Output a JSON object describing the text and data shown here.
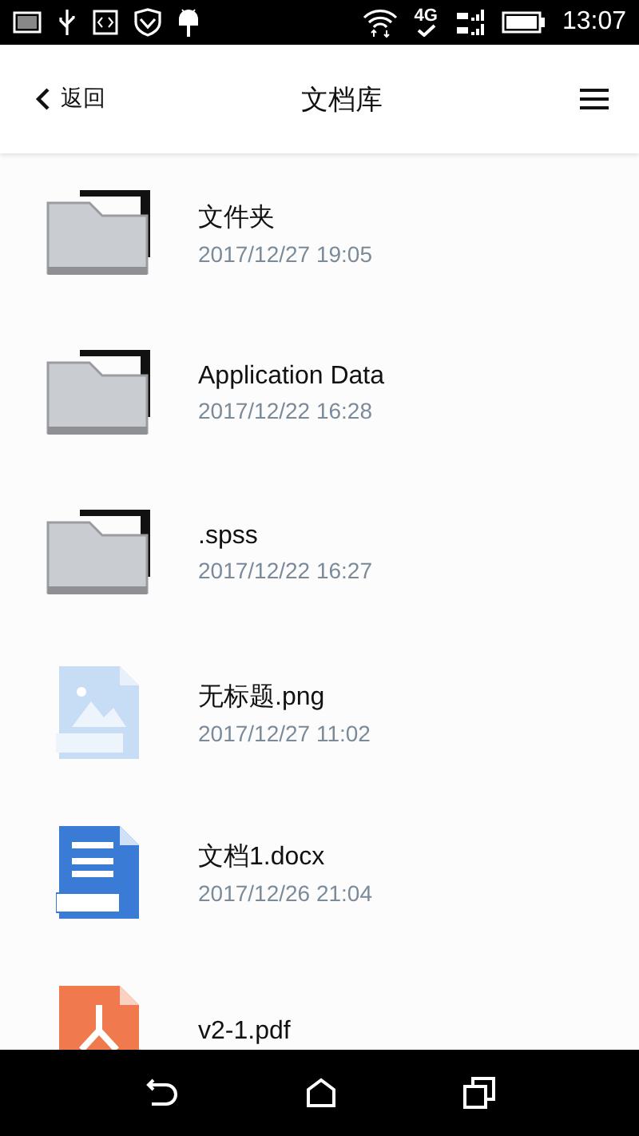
{
  "status_bar": {
    "network": "4G",
    "time": "13:07"
  },
  "header": {
    "back": "返回",
    "title": "文档库"
  },
  "files": [
    {
      "kind": "folder",
      "name": "文件夹",
      "date": "2017/12/27 19:05"
    },
    {
      "kind": "folder",
      "name": "Application Data",
      "date": "2017/12/22 16:28"
    },
    {
      "kind": "folder",
      "name": ".spss",
      "date": "2017/12/22 16:27"
    },
    {
      "kind": "image",
      "name": "无标题.png",
      "date": "2017/12/27 11:02"
    },
    {
      "kind": "word",
      "name": "文档1.docx",
      "date": "2017/12/26 21:04"
    },
    {
      "kind": "pdf",
      "name": "v2-1.pdf"
    }
  ]
}
